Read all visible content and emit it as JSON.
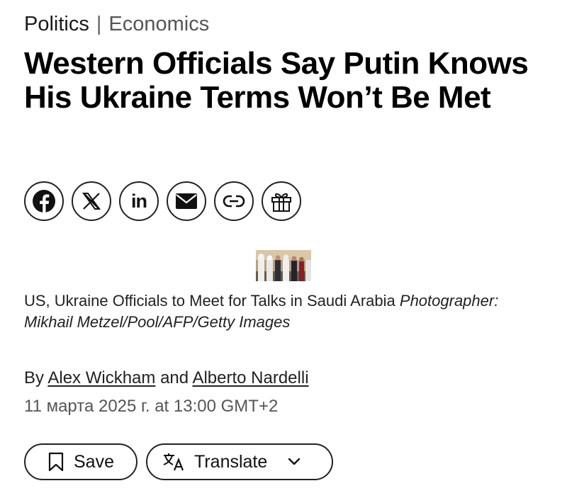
{
  "breadcrumb": {
    "section": "Politics",
    "separator": "|",
    "subsection": "Economics"
  },
  "headline": "Western Officials Say Putin Knows His Ukraine Terms Won’t Be Met",
  "share": {
    "icons": [
      "facebook-icon",
      "x-icon",
      "linkedin-icon",
      "email-icon",
      "link-icon",
      "gift-icon"
    ],
    "linkedin_text": "in"
  },
  "caption": {
    "text": "US, Ukraine Officials to Meet for Talks in Saudi Arabia",
    "credit": "Photographer: Mikhail Metzel/Pool/AFP/Getty Images"
  },
  "byline": {
    "prefix": "By",
    "author1": "Alex Wickham",
    "conjunction": "and",
    "author2": "Alberto Nardelli"
  },
  "dateline": "11 марта 2025 г. at 13:00 GMT+2",
  "actions": {
    "save_label": "Save",
    "translate_label": "Translate"
  }
}
